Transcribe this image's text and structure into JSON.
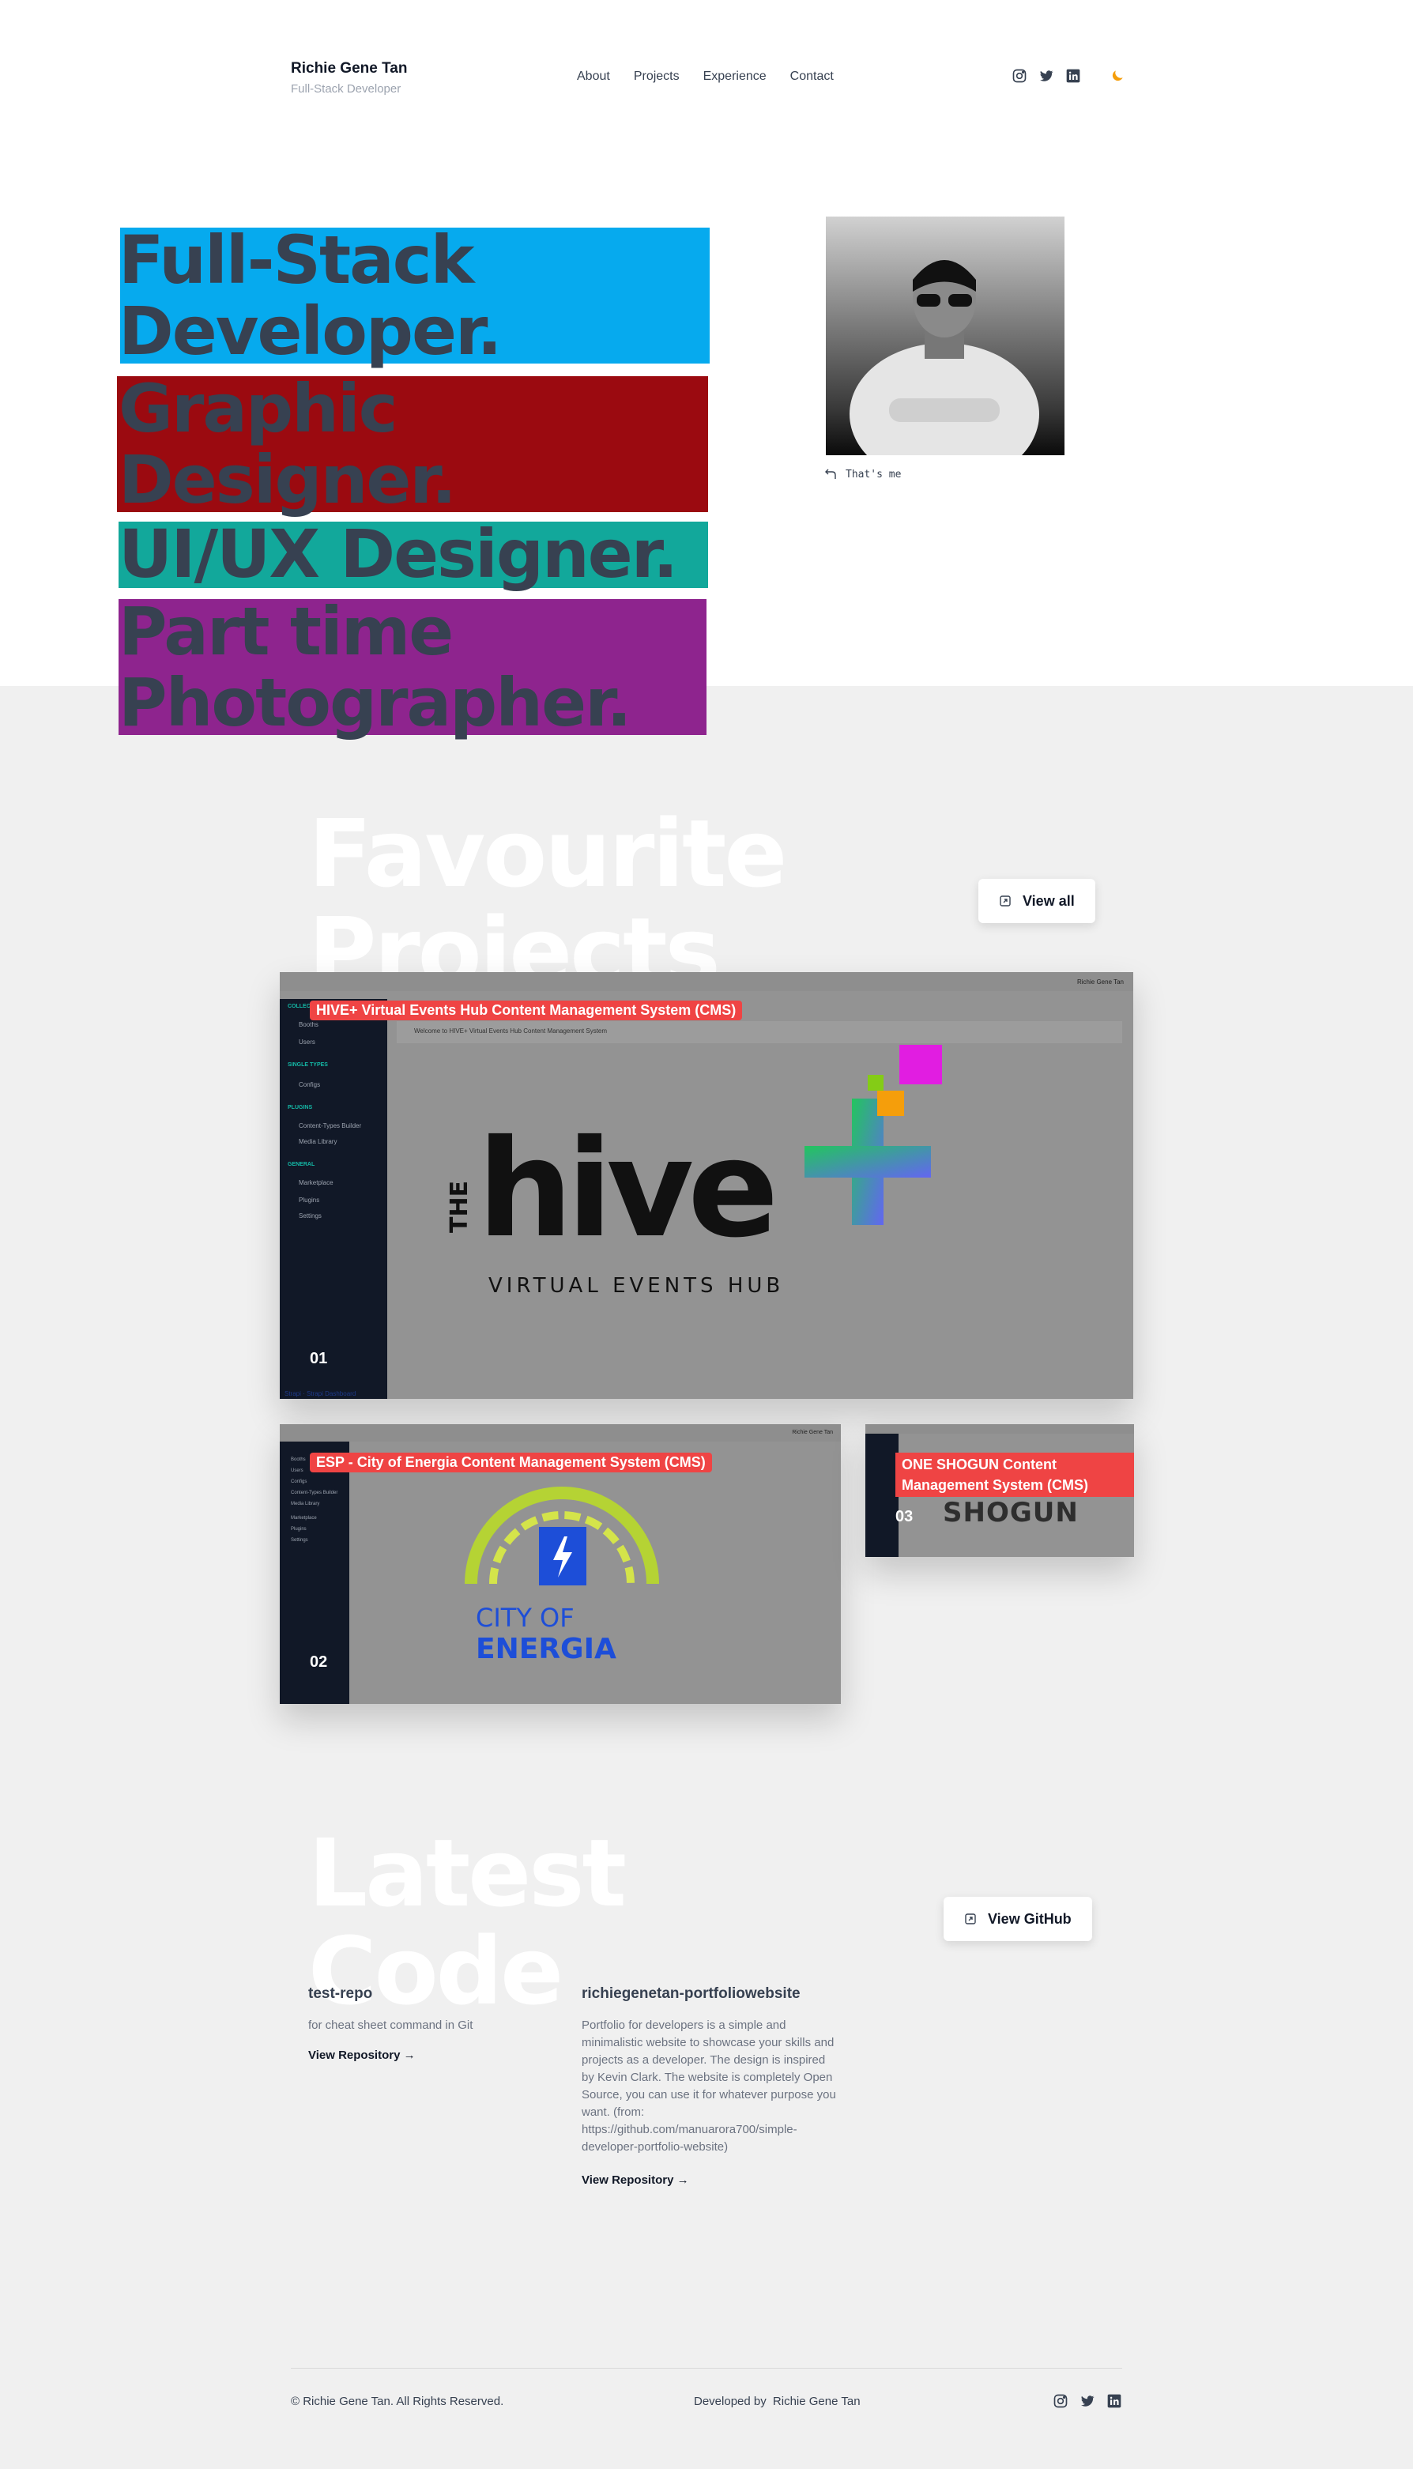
{
  "header": {
    "name": "Richie Gene Tan",
    "subtitle": "Full-Stack Developer",
    "nav": [
      "About",
      "Projects",
      "Experience",
      "Contact"
    ]
  },
  "hero": {
    "lines": [
      {
        "text": "Full-Stack\nDeveloper.",
        "color": "#06aaee"
      },
      {
        "text": "Graphic\nDesigner.",
        "color": "#9b0a10"
      },
      {
        "text": "UI/UX Designer.",
        "color": "#12a89b"
      },
      {
        "text": "Part time\nPhotographer.",
        "color": "#8e248e"
      }
    ],
    "photo_caption": "That's me"
  },
  "projects": {
    "title": "Favourite Projects",
    "view_all": "View all",
    "items": [
      {
        "number": "01",
        "label": "HIVE+ Virtual Events Hub Content Management System (CMS)",
        "logo_main": "hive",
        "logo_prefix": "THE",
        "logo_sub": "VIRTUAL EVENTS HUB",
        "topbar_user": "Richie Gene Tan",
        "welcome": "Welcome to HIVE+ Virtual Events Hub Content Management System"
      },
      {
        "number": "02",
        "label": "ESP - City of Energia Content Management System (CMS)",
        "logo_line1": "CITY OF",
        "logo_line2": "ENERGIA",
        "topbar_user": "Richie Gene Tan"
      },
      {
        "number": "03",
        "label": "ONE SHOGUN Content Management System (CMS)",
        "logo": "SHOGUN"
      }
    ],
    "sidebar_items": {
      "heads": [
        "COLLECTION TYPES",
        "SINGLE TYPES",
        "PLUGINS",
        "GENERAL"
      ],
      "items": [
        "Booths",
        "Users",
        "Configs",
        "Content-Types Builder",
        "Media Library",
        "Marketplace",
        "Plugins",
        "Settings"
      ]
    },
    "sidebar_footer": "Strapi · Strapi Dashboard"
  },
  "code": {
    "title": "Latest Code",
    "github_button": "View GitHub",
    "repos": [
      {
        "name": "test-repo",
        "description": "for cheat sheet command in Git",
        "link": "View Repository →"
      },
      {
        "name": "richiegenetan-portfoliowebsite",
        "description": "Portfolio for developers is a simple and minimalistic website to showcase your skills and projects as a developer. The design is inspired by Kevin Clark. The website is completely Open Source, you can use it for whatever purpose you want. (from: https://github.com/manuarora700/simple-developer-portfolio-website)",
        "link": "View Repository →"
      }
    ]
  },
  "footer": {
    "copyright": "© Richie Gene Tan. All Rights Reserved.",
    "developed_by_label": "Developed by",
    "developer": "Richie Gene Tan"
  },
  "colors": {
    "accent": "#f59e0b",
    "label_red": "#ef4444",
    "sidebar": "#111827",
    "teal": "#14b8a6"
  },
  "icons": [
    "instagram-icon",
    "twitter-icon",
    "linkedin-icon",
    "moon-icon",
    "return-arrow-icon",
    "external-link-icon"
  ]
}
